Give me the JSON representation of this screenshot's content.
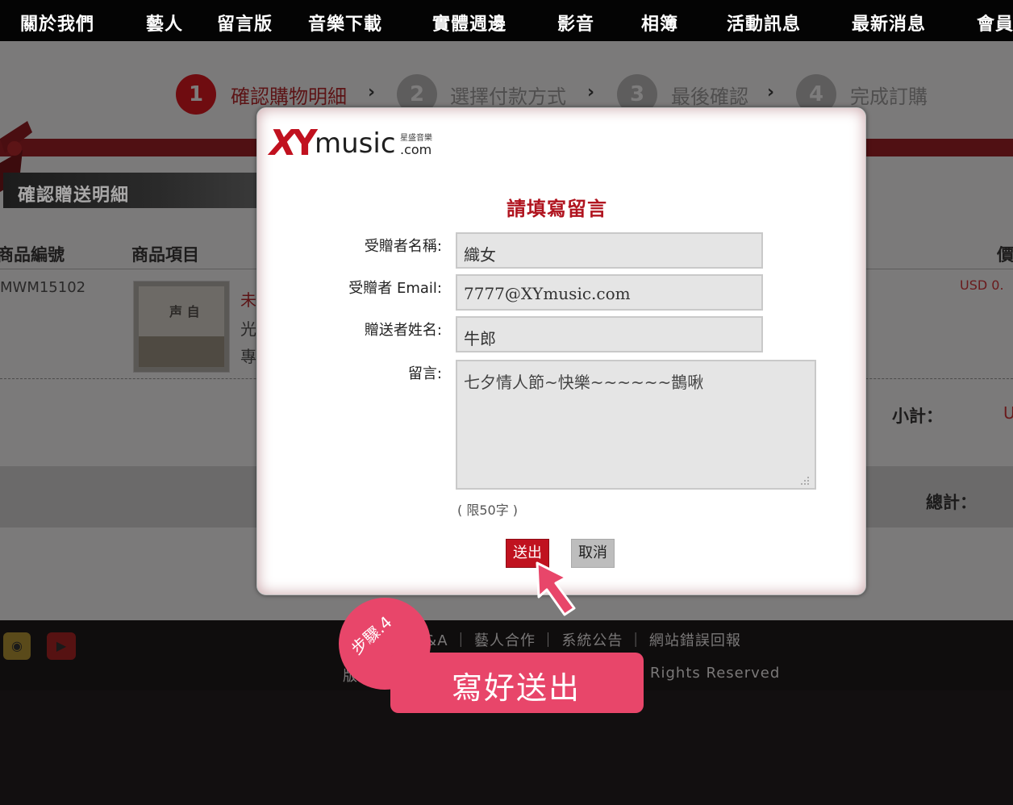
{
  "nav": {
    "items": [
      "關於我們",
      "藝人",
      "留言版",
      "音樂下載",
      "實體週邊",
      "影音",
      "相簿",
      "活動訊息",
      "最新消息",
      "會員"
    ]
  },
  "steps": [
    {
      "num": "1",
      "label": "確認購物明細"
    },
    {
      "num": "2",
      "label": "選擇付款方式"
    },
    {
      "num": "3",
      "label": "最後確認"
    },
    {
      "num": "4",
      "label": "完成訂購"
    }
  ],
  "step_separator": "›",
  "section": {
    "title": "確認贈送明細"
  },
  "table": {
    "col_code": "商品編號",
    "col_item": "商品項目",
    "col_price": "價",
    "product_code": "MWM15102",
    "album_art_text": "声 自",
    "item_line1": "未",
    "item_line2": "光",
    "item_line3": "專",
    "price_fragment": "USD 0.",
    "subtotal_label": "小計：",
    "subtotal_value": "U",
    "total_label": "總計："
  },
  "footer": {
    "weibo_glyph": "◉",
    "youtube_glyph": "▶",
    "links": "Q&A ｜ 藝人合作 ｜ 系統公告 ｜ 網站錯誤回報",
    "copyright_left": "版",
    "copyright": "Rights Reserved"
  },
  "modal": {
    "logo_x": "X",
    "logo_y": "Y",
    "logo_music": "music",
    "logo_com": ".com",
    "logo_tag": "星盛音樂",
    "title": "請填寫留言",
    "recipient_name_label": "受贈者名稱:",
    "recipient_name_value": "織女",
    "recipient_email_label": "受贈者 Email:",
    "recipient_email_value": "7777@XYmusic.com",
    "sender_name_label": "贈送者姓名:",
    "sender_name_value": "牛郎",
    "message_label": "留言:",
    "message_value": "七夕情人節~快樂~~~~~~鵲啾",
    "limit_text": "( 限50字 )",
    "submit_label": "送出",
    "cancel_label": "取消"
  },
  "callout": {
    "step": "步驟.4",
    "text": "寫好送出"
  },
  "colors": {
    "brand_red": "#c0121f",
    "callout_pink": "#e8466a",
    "nav_bg": "#040404"
  }
}
